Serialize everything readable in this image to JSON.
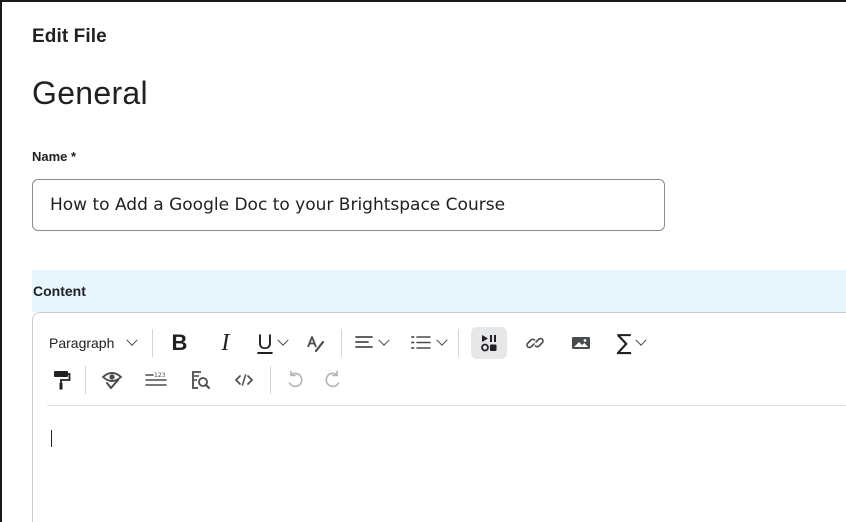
{
  "page": {
    "header": "Edit File",
    "section_title": "General"
  },
  "name_field": {
    "label": "Name *",
    "value": "How to Add a Google Doc to your Brightspace Course"
  },
  "content": {
    "label": "Content"
  },
  "editor": {
    "paragraph_select": "Paragraph",
    "bold": "B",
    "italic": "I",
    "underline": "U",
    "sigma": "∑",
    "icons": [
      "chevron-down-icon",
      "bold-icon",
      "italic-icon",
      "underline-icon",
      "text-color-icon",
      "align-icon",
      "list-icon",
      "media-icon",
      "link-icon",
      "image-icon",
      "equation-icon",
      "format-painter-icon",
      "accessibility-check-icon",
      "word-count-icon",
      "find-replace-icon",
      "source-code-icon",
      "undo-icon",
      "redo-icon"
    ],
    "colors": {
      "active_button": "#e6e7e9",
      "content_band": "#e8f6fd",
      "icon": "#494c4e"
    }
  }
}
